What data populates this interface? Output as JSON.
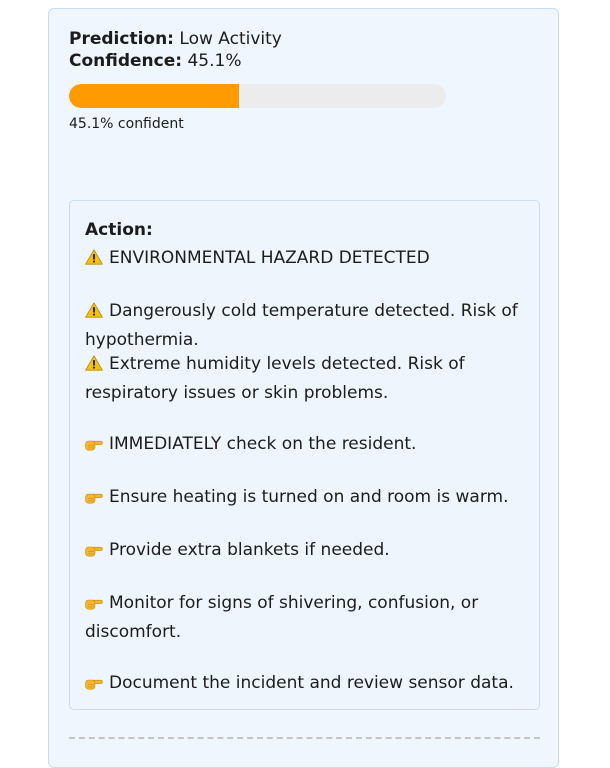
{
  "prediction": {
    "label": "Prediction:",
    "value": "Low Activity"
  },
  "confidence": {
    "label": "Confidence:",
    "value": "45.1%",
    "fraction": 0.451,
    "caption": "45.1% confident",
    "bar_color": "#ff9b00",
    "track_color": "#ececec"
  },
  "action": {
    "title": "Action:",
    "lines": [
      {
        "icon": "warning-icon",
        "text": "ENVIRONMENTAL HAZARD DETECTED"
      },
      {
        "icon": "warning-icon",
        "text": "Dangerously cold temperature detected. Risk of hypothermia."
      },
      {
        "icon": "warning-icon",
        "text": "Extreme humidity levels detected. Risk of respiratory issues or skin problems."
      },
      {
        "icon": "pointing-hand-icon",
        "text": "IMMEDIATELY check on the resident."
      },
      {
        "icon": "pointing-hand-icon",
        "text": "Ensure heating is turned on and room is warm."
      },
      {
        "icon": "pointing-hand-icon",
        "text": "Provide extra blankets if needed."
      },
      {
        "icon": "pointing-hand-icon",
        "text": "Monitor for signs of shivering, confusion, or discomfort."
      },
      {
        "icon": "pointing-hand-icon",
        "text": "Document the incident and review sensor data."
      }
    ]
  },
  "colors": {
    "card_background": "#eff6fd",
    "border": "#c9dcef",
    "accent": "#ff9b00"
  }
}
